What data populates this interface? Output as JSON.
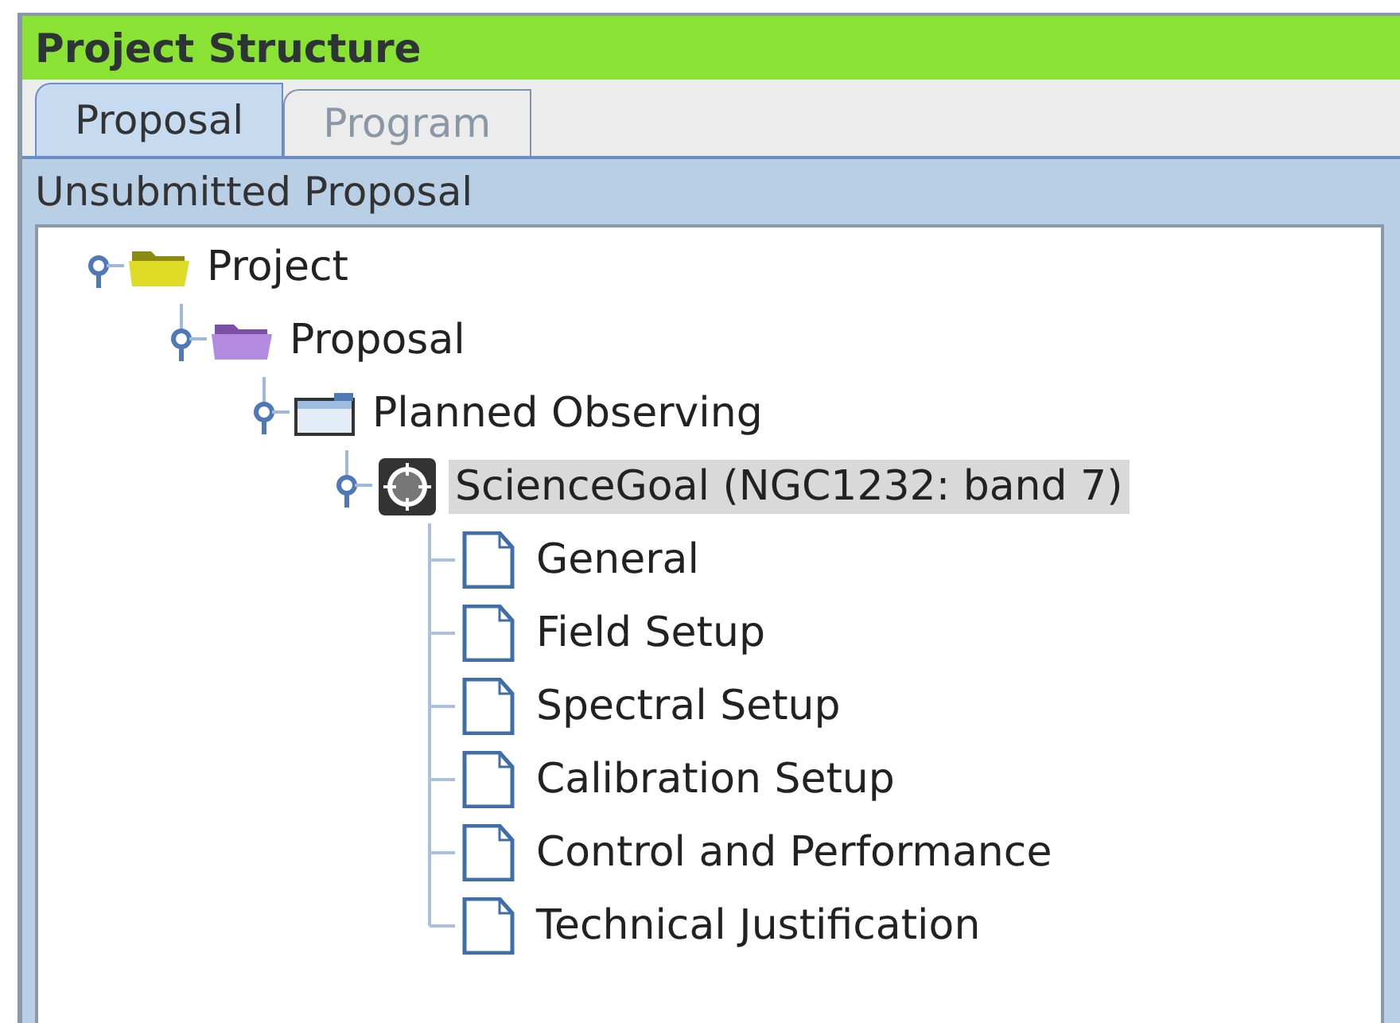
{
  "window": {
    "title": "Project Structure"
  },
  "tabs": [
    {
      "label": "Proposal",
      "selected": true
    },
    {
      "label": "Program",
      "selected": false
    }
  ],
  "panel": {
    "title": "Unsubmitted Proposal"
  },
  "tree": [
    {
      "label": "Project",
      "kind": "project",
      "expanded": true,
      "selected": false,
      "children": [
        {
          "label": "Proposal",
          "kind": "proposal",
          "expanded": true,
          "selected": false,
          "children": [
            {
              "label": "Planned Observing",
              "kind": "container",
              "expanded": true,
              "selected": false,
              "children": [
                {
                  "label": "ScienceGoal (NGC1232: band 7)",
                  "kind": "goal",
                  "expanded": true,
                  "selected": true,
                  "children": [
                    {
                      "label": "General",
                      "kind": "document",
                      "selected": false
                    },
                    {
                      "label": "Field Setup",
                      "kind": "document",
                      "selected": false
                    },
                    {
                      "label": "Spectral Setup",
                      "kind": "document",
                      "selected": false
                    },
                    {
                      "label": "Calibration Setup",
                      "kind": "document",
                      "selected": false
                    },
                    {
                      "label": "Control and Performance",
                      "kind": "document",
                      "selected": false
                    },
                    {
                      "label": "Technical Justification",
                      "kind": "document",
                      "selected": false
                    }
                  ]
                }
              ]
            }
          ]
        }
      ]
    }
  ]
}
